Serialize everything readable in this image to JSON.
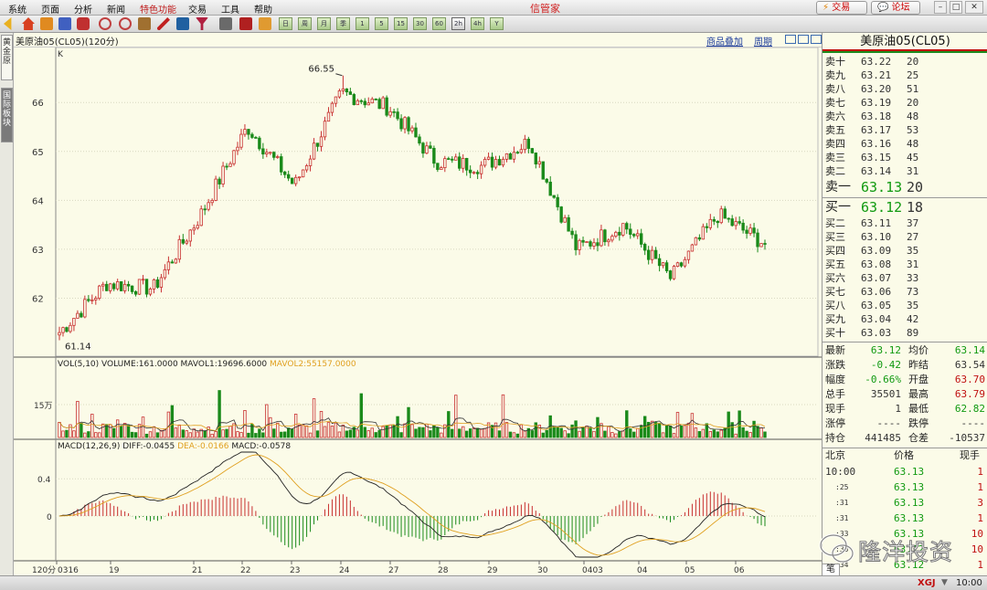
{
  "app": {
    "title": "信管家"
  },
  "menu": [
    "系统",
    "页面",
    "分析",
    "新闻",
    "特色功能",
    "交易",
    "工具",
    "帮助"
  ],
  "top_buttons": {
    "trade": "交易",
    "forum": "论坛"
  },
  "toolbar": {
    "periods": [
      "日",
      "周",
      "月",
      "季",
      "1",
      "5",
      "15",
      "30",
      "60",
      "2h",
      "4h",
      "Y"
    ]
  },
  "left_tabs": {
    "tab1": "黄金原",
    "tab2": "国际板块"
  },
  "chart": {
    "header_label": "美原油05(CL05)(120分)",
    "overlay_label": "商品叠加",
    "period_label": "周期",
    "k_marker": "K",
    "price_ticks": [
      "66",
      "65",
      "64",
      "63",
      "62"
    ],
    "high_label": "66.55",
    "low_label": "61.14",
    "volume_legend": {
      "prefix": "VOL(5,10) VOLUME:161.0000",
      "mavol1": "MAVOL1:19696.6000",
      "mavol2": "MAVOL2:55157.0000"
    },
    "volume_tick": "15万",
    "macd_legend": {
      "prefix": "MACD(12,26,9)",
      "diff": "DIFF:-0.0455",
      "dea": "DEA:-0.0166",
      "macd": "MACD:-0.0578"
    },
    "macd_ticks": [
      "0.4",
      "0"
    ],
    "period_axis": "120分",
    "date_ticks": [
      "0316",
      "19",
      "21",
      "22",
      "23",
      "24",
      "27",
      "28",
      "29",
      "30",
      "0403",
      "04",
      "05",
      "06"
    ],
    "colors": {
      "up": "#c83030",
      "down": "#1a8a1a",
      "background": "#fbfbe8",
      "diff": "#222222",
      "dea": "#e0a020"
    }
  },
  "chart_data": {
    "type": "candlestick",
    "instrument": "美原油05(CL05)",
    "interval": "120分",
    "price_range": [
      61.0,
      66.9
    ],
    "annotated_high": 66.55,
    "annotated_low": 61.14,
    "key_closes": [
      61.3,
      62.3,
      62.2,
      63.7,
      65.5,
      64.3,
      66.2,
      65.9,
      64.8,
      64.7,
      65.2,
      63.0,
      63.5,
      62.4,
      63.7,
      63.12
    ]
  },
  "quote": {
    "title": "美原油05(CL05)",
    "asks": [
      {
        "label": "卖十",
        "price": "63.22",
        "vol": "20"
      },
      {
        "label": "卖九",
        "price": "63.21",
        "vol": "25"
      },
      {
        "label": "卖八",
        "price": "63.20",
        "vol": "51"
      },
      {
        "label": "卖七",
        "price": "63.19",
        "vol": "20"
      },
      {
        "label": "卖六",
        "price": "63.18",
        "vol": "48"
      },
      {
        "label": "卖五",
        "price": "63.17",
        "vol": "53"
      },
      {
        "label": "卖四",
        "price": "63.16",
        "vol": "48"
      },
      {
        "label": "卖三",
        "price": "63.15",
        "vol": "45"
      },
      {
        "label": "卖二",
        "price": "63.14",
        "vol": "31"
      },
      {
        "label": "卖一",
        "price": "63.13",
        "vol": "20"
      }
    ],
    "bids": [
      {
        "label": "买一",
        "price": "63.12",
        "vol": "18"
      },
      {
        "label": "买二",
        "price": "63.11",
        "vol": "37"
      },
      {
        "label": "买三",
        "price": "63.10",
        "vol": "27"
      },
      {
        "label": "买四",
        "price": "63.09",
        "vol": "35"
      },
      {
        "label": "买五",
        "price": "63.08",
        "vol": "31"
      },
      {
        "label": "买六",
        "price": "63.07",
        "vol": "33"
      },
      {
        "label": "买七",
        "price": "63.06",
        "vol": "73"
      },
      {
        "label": "买八",
        "price": "63.05",
        "vol": "35"
      },
      {
        "label": "买九",
        "price": "63.04",
        "vol": "42"
      },
      {
        "label": "买十",
        "price": "63.03",
        "vol": "89"
      }
    ],
    "stats": [
      {
        "l1": "最新",
        "v1": "63.12",
        "c1": "#119a11",
        "l2": "均价",
        "v2": "63.14",
        "c2": "#119a11"
      },
      {
        "l1": "涨跌",
        "v1": "-0.42",
        "c1": "#119a11",
        "l2": "昨结",
        "v2": "63.54",
        "c2": "#333333"
      },
      {
        "l1": "幅度",
        "v1": "-0.66%",
        "c1": "#119a11",
        "l2": "开盘",
        "v2": "63.70",
        "c2": "#c01010"
      },
      {
        "l1": "总手",
        "v1": "35501",
        "c1": "#333333",
        "l2": "最高",
        "v2": "63.79",
        "c2": "#c01010"
      },
      {
        "l1": "现手",
        "v1": "1",
        "c1": "#333333",
        "l2": "最低",
        "v2": "62.82",
        "c2": "#119a11"
      },
      {
        "l1": "涨停",
        "v1": "----",
        "c1": "#333333",
        "l2": "跌停",
        "v2": "----",
        "c2": "#333333"
      },
      {
        "l1": "持仓",
        "v1": "441485",
        "c1": "#333333",
        "l2": "仓差",
        "v2": "-10537",
        "c2": "#333333"
      }
    ],
    "ticks_header": {
      "time": "北京",
      "price": "价格",
      "vol": "现手"
    },
    "ticks": [
      {
        "time": "10:00",
        "price": "63.13",
        "vol": "1"
      },
      {
        "time": ":25",
        "price": "63.13",
        "vol": "1"
      },
      {
        "time": ":31",
        "price": "63.13",
        "vol": "3"
      },
      {
        "time": ":31",
        "price": "63.13",
        "vol": "1"
      },
      {
        "time": ":33",
        "price": "63.13",
        "vol": "10"
      },
      {
        "time": ":33",
        "price": "63.12",
        "vol": "10"
      },
      {
        "time": ":34",
        "price": "63.12",
        "vol": "1"
      }
    ],
    "bottom_tab": "笔"
  },
  "status": {
    "brand": "XGJ",
    "time": "10:00"
  },
  "watermark": "隆洋投资"
}
